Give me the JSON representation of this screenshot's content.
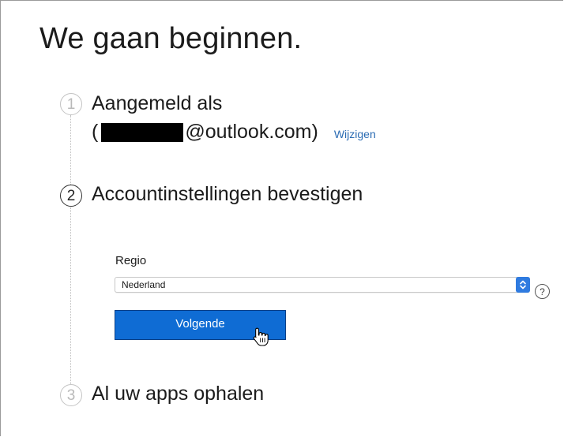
{
  "page": {
    "title": "We gaan beginnen."
  },
  "steps": [
    {
      "number": "1",
      "label": "Aangemeld als",
      "state": "done"
    },
    {
      "number": "2",
      "label": "Accountinstellingen bevestigen",
      "state": "active"
    },
    {
      "number": "3",
      "label": "Al uw apps ophalen",
      "state": "pending"
    }
  ],
  "account": {
    "open_paren": "(",
    "email_suffix": "@outlook.com)",
    "change_link": "Wijzigen"
  },
  "region": {
    "label": "Regio",
    "selected": "Nederland",
    "help_glyph": "?"
  },
  "actions": {
    "next_label": "Volgende"
  },
  "colors": {
    "button_blue": "#0f6cd4",
    "link_blue": "#2a6bb3",
    "select_arrow_blue": "#2f7be0"
  },
  "icons": {
    "select_arrows": "up-down-chevron-icon",
    "help": "question-mark-circle-icon",
    "cursor": "hand-pointer-icon",
    "redaction": "redaction-bar"
  }
}
